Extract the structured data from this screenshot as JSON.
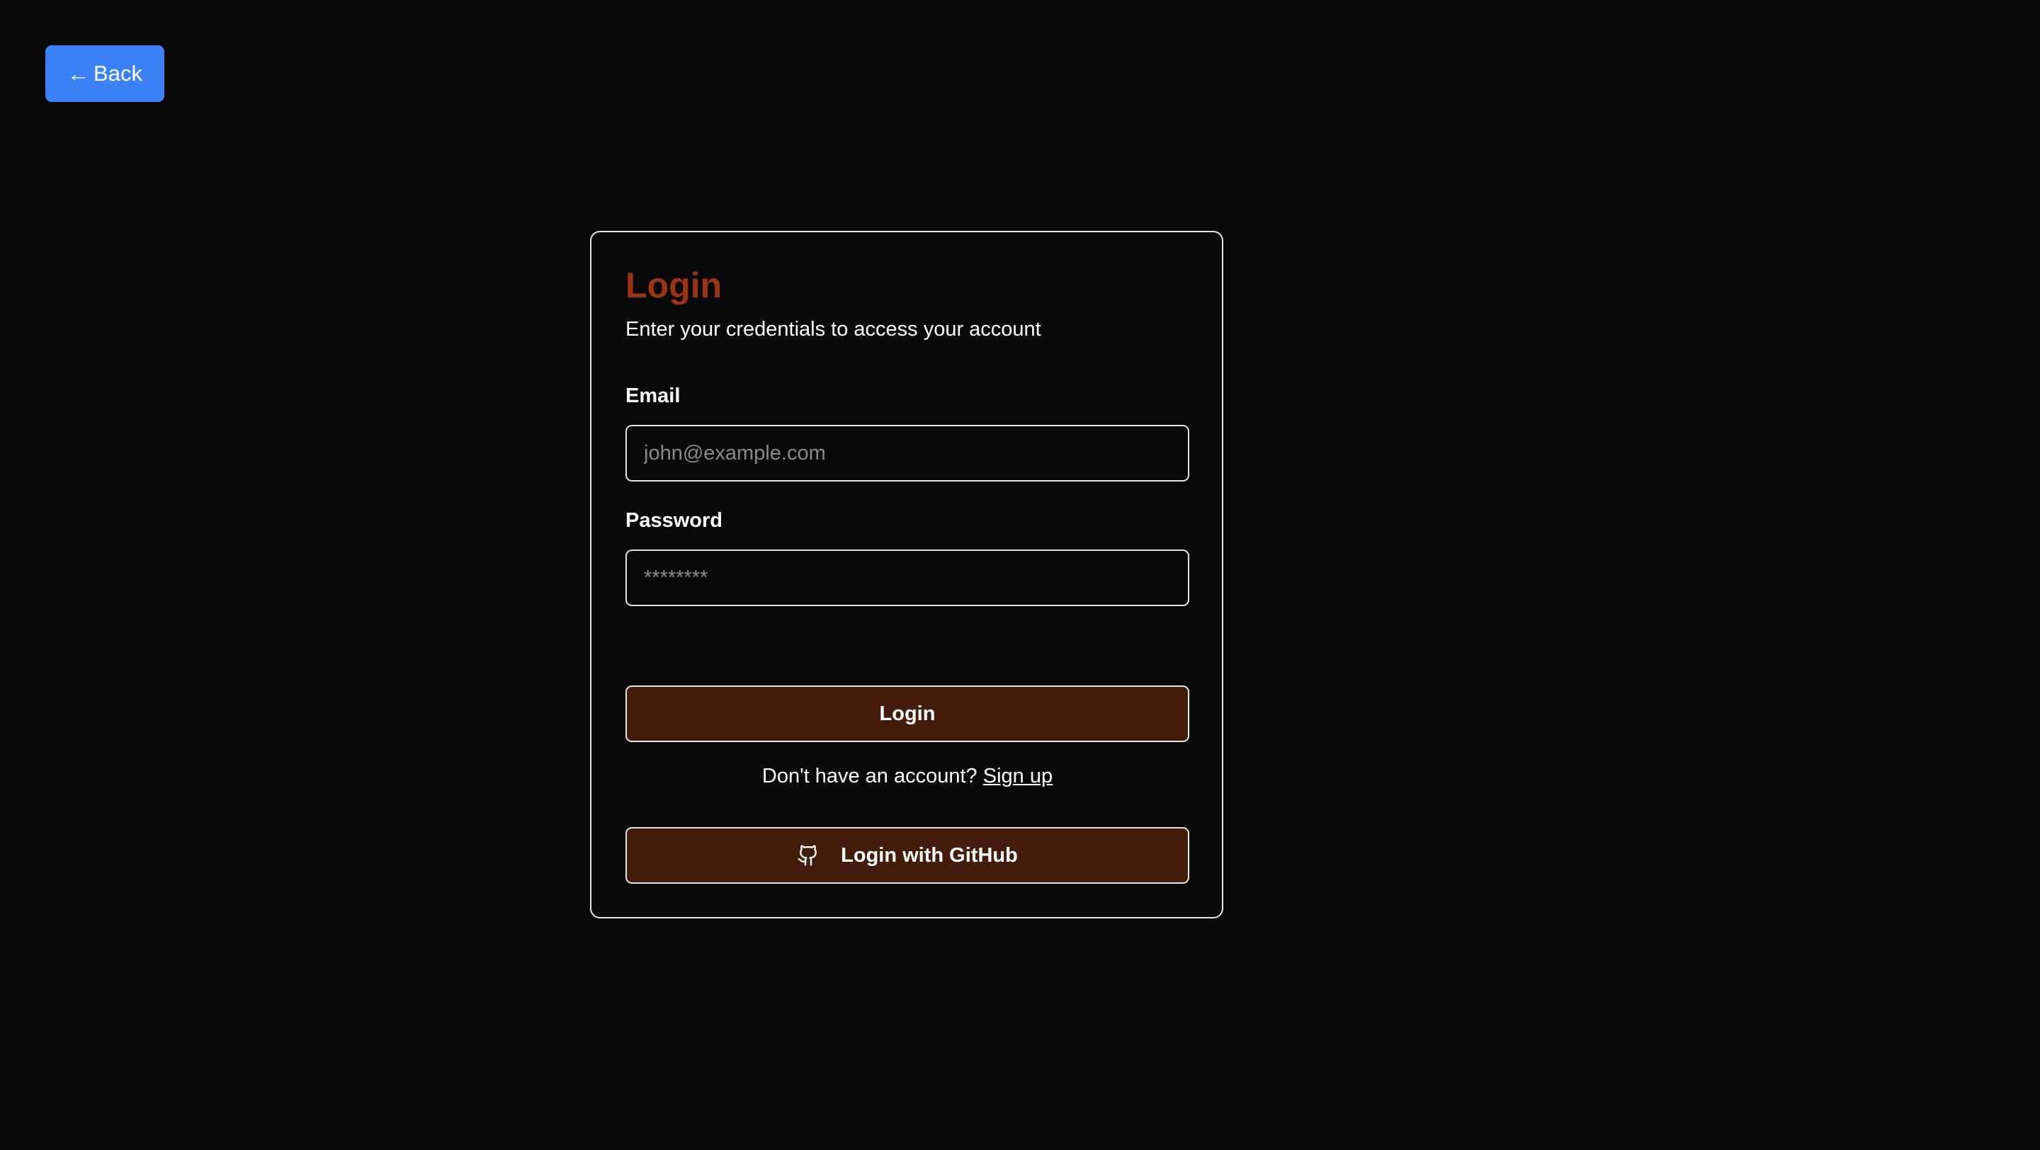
{
  "back": {
    "label": "Back",
    "icon": "arrow-left-icon"
  },
  "card": {
    "title": "Login",
    "subtitle": "Enter your credentials to access your account",
    "email": {
      "label": "Email",
      "placeholder": "john@example.com",
      "value": ""
    },
    "password": {
      "label": "Password",
      "placeholder": "********",
      "value": ""
    },
    "login_button": "Login",
    "signup": {
      "prompt": "Don't have an account?",
      "link": "Sign up"
    },
    "github_button": {
      "label": "Login with GitHub",
      "icon": "github-icon"
    }
  },
  "colors": {
    "background": "#0a0a0a",
    "back_button": "#3b82f6",
    "title": "#9a3412",
    "primary_button": "#431c0c",
    "border": "#e5e5e5"
  }
}
